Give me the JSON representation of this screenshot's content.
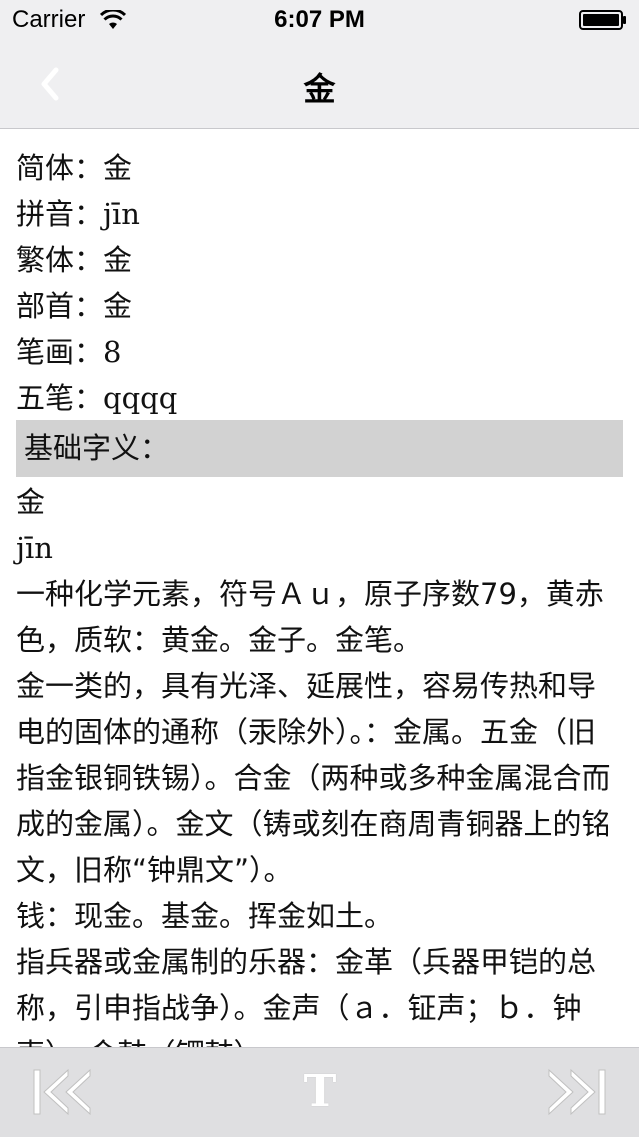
{
  "status_bar": {
    "carrier": "Carrier",
    "time": "6:07 PM"
  },
  "nav": {
    "title": "金",
    "back_icon": "chevron-left-icon"
  },
  "info": [
    {
      "label": "简体：",
      "value": "金"
    },
    {
      "label": "拼音：",
      "value": "jīn"
    },
    {
      "label": "繁体：",
      "value": "金"
    },
    {
      "label": "部首：",
      "value": "金"
    },
    {
      "label": "笔画：",
      "value": "8"
    },
    {
      "label": "五笔：",
      "value": "qqqq"
    }
  ],
  "section": {
    "title": "基础字义："
  },
  "definition": {
    "char": "金",
    "pinyin": "jīn",
    "paragraphs": [
      "一种化学元素，符号Ａｕ，原子序数79，黄赤色，质软：黄金。金子。金笔。",
      "金一类的，具有光泽、延展性，容易传热和导电的固体的通称（汞除外）。：金属。五金（旧指金银铜铁锡）。合金（两种或多种金属混合而成的金属）。金文（铸或刻在商周青铜器上的铭文，旧称“钟鼎文”）。",
      "钱：现金。基金。挥金如土。",
      "指兵器或金属制的乐器：金革（兵器甲铠的总称，引申指战争）。金声（ａ．钲声；ｂ．钟声）。金鼓（锣鼓）"
    ]
  },
  "toolbar": {
    "font_label": "T",
    "prev_icon": "skip-back-icon",
    "next_icon": "skip-forward-icon"
  },
  "colors": {
    "bar_background": "#efeff1",
    "section_background": "#d2d2d2",
    "toolbar_background": "#dfdfe1"
  }
}
